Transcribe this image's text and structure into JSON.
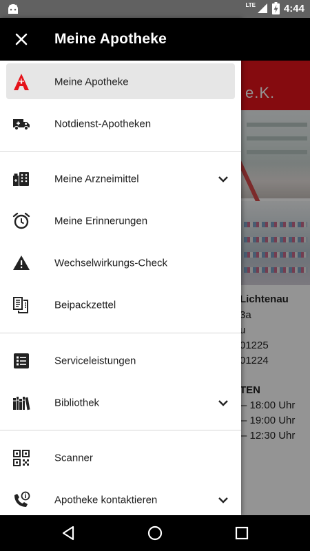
{
  "status_bar": {
    "time": "4:44",
    "network": "LTE",
    "icons": [
      "android-debug-icon",
      "signal-icon",
      "battery-charging-icon"
    ]
  },
  "background_app": {
    "header_text": "e.K.",
    "pharmacy_name": "Lichtenau",
    "address_line": "3a",
    "city_line": "u",
    "phone": "01225",
    "fax": "01224",
    "hours_title": "TEN",
    "hours": [
      "– 18:00 Uhr",
      "– 19:00 Uhr",
      "– 12:30 Uhr"
    ]
  },
  "drawer": {
    "title": "Meine Apotheke",
    "accent_color": "#e5131a",
    "items": [
      {
        "label": "Meine Apotheke",
        "icon": "apotheke-logo-icon",
        "active": true
      },
      {
        "label": "Notdienst-Apotheken",
        "icon": "ambulance-icon"
      },
      {
        "label": "Meine Arzneimittel",
        "icon": "medicine-icon",
        "expandable": true
      },
      {
        "label": "Meine Erinnerungen",
        "icon": "alarm-clock-icon"
      },
      {
        "label": "Wechselwirkungs-Check",
        "icon": "warning-icon"
      },
      {
        "label": "Beipackzettel",
        "icon": "leaflet-icon"
      },
      {
        "label": "Serviceleistungen",
        "icon": "service-list-icon"
      },
      {
        "label": "Bibliothek",
        "icon": "library-icon",
        "expandable": true
      },
      {
        "label": "Scanner",
        "icon": "qr-code-icon"
      },
      {
        "label": "Apotheke kontaktieren",
        "icon": "phone-info-icon",
        "expandable": true
      }
    ]
  },
  "nav_bar": {
    "buttons": [
      "back-icon",
      "home-icon",
      "recents-icon"
    ]
  }
}
